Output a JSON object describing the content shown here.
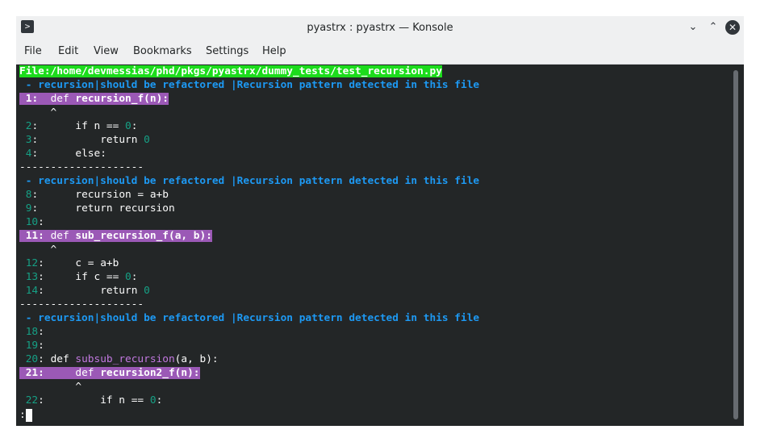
{
  "window": {
    "title": "pyastrx : pyastrx — Konsole",
    "buttons": {
      "minimize": "⌄",
      "maximize": "⌃",
      "close": "✕"
    }
  },
  "menubar": {
    "items": [
      "File",
      "Edit",
      "View",
      "Bookmarks",
      "Settings",
      "Help"
    ]
  },
  "terminal": {
    "file_header": "File:/home/devmessias/phd/pkgs/pyastrx/dummy_tests/test_recursion.py",
    "separator": "--------------------",
    "match_message": " - recursion|should be refactored |Recursion pattern detected in this file",
    "caret": "^",
    "prompt": ":",
    "blocks": [
      {
        "lines": [
          {
            "no": "1",
            "colon": ":",
            "indent": "  ",
            "kw": "def ",
            "name": "recursion_f",
            "rest": "(n):",
            "highlight": true
          },
          {
            "no": "2",
            "colon": ":",
            "text": "      if n == ",
            "lit": "0",
            "tail": ":"
          },
          {
            "no": "3",
            "colon": ":",
            "text": "          return ",
            "lit": "0",
            "tail": ""
          },
          {
            "no": "4",
            "colon": ":",
            "text": "      else:",
            "lit": "",
            "tail": ""
          }
        ]
      },
      {
        "lines": [
          {
            "no": "8",
            "colon": ":",
            "text": "      recursion = a+b"
          },
          {
            "no": "9",
            "colon": ":",
            "text": "      return recursion"
          },
          {
            "no": "10",
            "colon": ":",
            "text": ""
          },
          {
            "no": "11",
            "colon": ":",
            "indent": " ",
            "kw": "def ",
            "name": "sub_recursion_f",
            "rest": "(a, b):",
            "highlight": true
          },
          {
            "no": "12",
            "colon": ":",
            "text": "     c = a+b"
          },
          {
            "no": "13",
            "colon": ":",
            "text": "     if c == ",
            "lit": "0",
            "tail": ":"
          },
          {
            "no": "14",
            "colon": ":",
            "text": "         return ",
            "lit": "0",
            "tail": ""
          }
        ]
      },
      {
        "lines": [
          {
            "no": "18",
            "colon": ":",
            "text": ""
          },
          {
            "no": "19",
            "colon": ":",
            "text": ""
          },
          {
            "no": "20",
            "colon": ":",
            "text": " def ",
            "fn": "subsub_recursion",
            "tail": "(a, b):"
          },
          {
            "no": "21",
            "colon": ":",
            "indent": "     ",
            "kw": "def ",
            "name": "recursion2_f",
            "rest": "(n):",
            "highlight": true
          },
          {
            "no": "22",
            "colon": ":",
            "text": "         if n == ",
            "lit": "0",
            "tail": ":"
          }
        ]
      }
    ]
  },
  "colors": {
    "background": "#232627",
    "foreground": "#fcfcfc",
    "file_highlight": "#1cdc1c",
    "match_highlight": "#9b59b6",
    "message_blue": "#1d99f3",
    "number_teal": "#16a085"
  }
}
